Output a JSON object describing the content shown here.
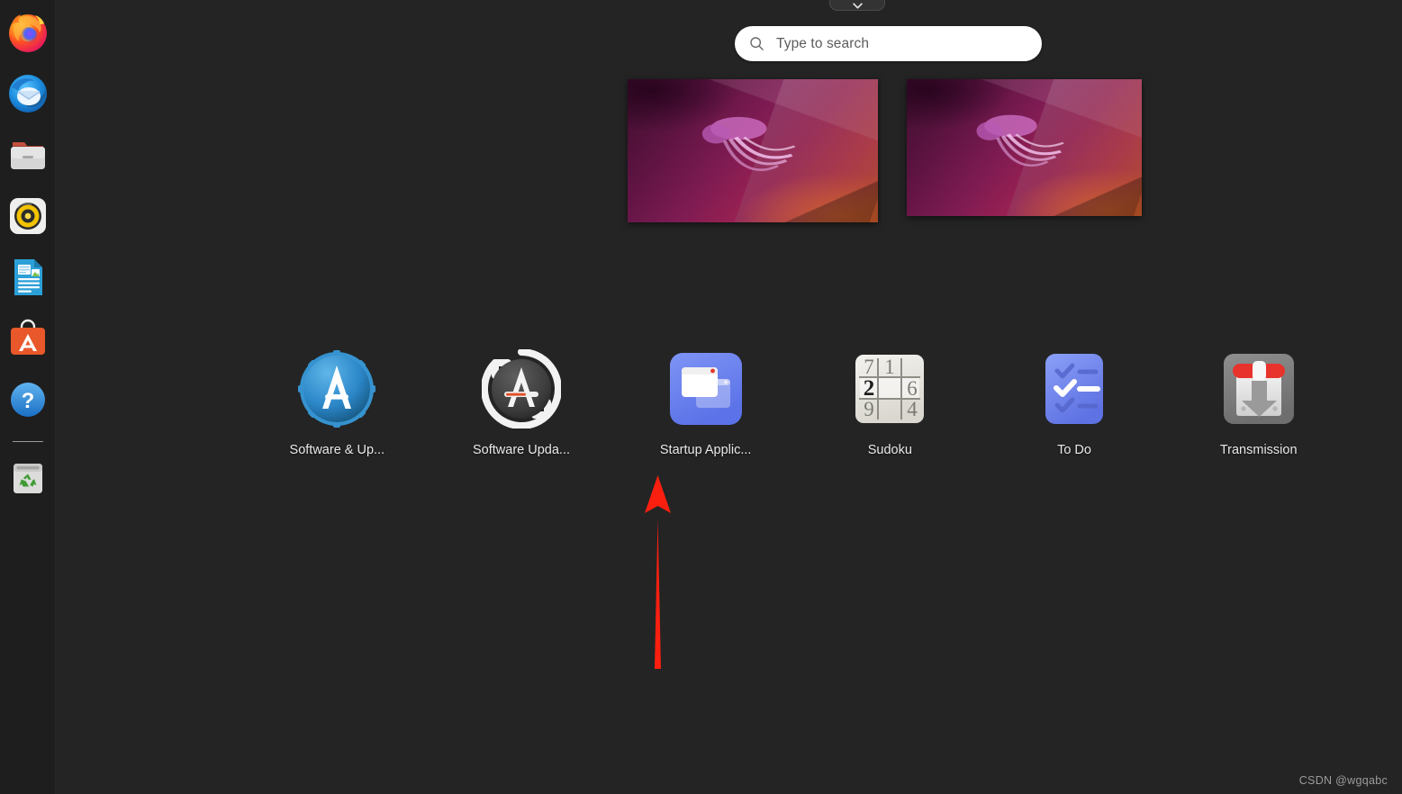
{
  "shell": {
    "name": "GNOME Shell Activities Overview",
    "background_color": "#242424",
    "dock_background_color": "#1e1e1e"
  },
  "top_popover": {
    "name": "system-menu-popover",
    "icon": "chevron-down-icon"
  },
  "dock": {
    "items": [
      {
        "label": "Firefox",
        "icon": "firefox-icon"
      },
      {
        "label": "Thunderbird Mail",
        "icon": "thunderbird-icon"
      },
      {
        "label": "Files",
        "icon": "files-folder-icon"
      },
      {
        "label": "Rhythmbox",
        "icon": "rhythmbox-icon"
      },
      {
        "label": "LibreOffice Writer",
        "icon": "libreoffice-writer-icon"
      },
      {
        "label": "Ubuntu Software",
        "icon": "ubuntu-software-icon"
      },
      {
        "label": "Help",
        "icon": "help-question-icon"
      }
    ],
    "trash": {
      "label": "Trash",
      "icon": "trash-recycle-icon"
    }
  },
  "search": {
    "placeholder": "Type to search",
    "value": "",
    "icon": "search-icon"
  },
  "workspaces": {
    "thumbnails": [
      {
        "label": "Workspace 1",
        "wallpaper": "Jammy Jellyfish"
      },
      {
        "label": "Workspace 2",
        "wallpaper": "Jammy Jellyfish"
      }
    ]
  },
  "app_grid": {
    "apps": [
      {
        "label": "Software & Up...",
        "icon": "software-and-updates-icon"
      },
      {
        "label": "Software Upda...",
        "icon": "software-updater-icon"
      },
      {
        "label": "Startup Applic...",
        "icon": "startup-applications-icon"
      },
      {
        "label": "Sudoku",
        "icon": "sudoku-icon"
      },
      {
        "label": "To Do",
        "icon": "todo-icon"
      },
      {
        "label": "Transmission",
        "icon": "transmission-icon"
      }
    ]
  },
  "sudoku_icon": {
    "cells": [
      "7",
      "1",
      "",
      "2",
      "",
      "6",
      "9",
      "",
      "4"
    ],
    "highlighted_index": 3
  },
  "annotation": {
    "type": "arrow",
    "direction": "up",
    "color": "#fb1f10",
    "points_to": "Startup Applic..."
  },
  "watermark": {
    "text": "CSDN @wgqabc"
  }
}
